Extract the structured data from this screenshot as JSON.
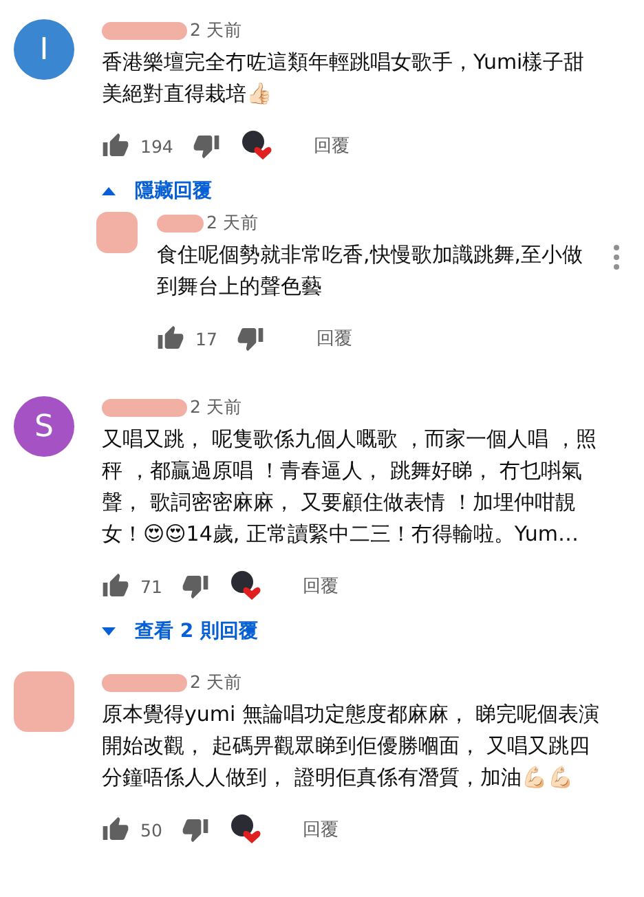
{
  "comments": [
    {
      "avatar": {
        "kind": "letter",
        "letter": "I",
        "color": "#3a86d1"
      },
      "time": "2 天前",
      "text": "香港樂壇完全冇咗這類年輕跳唱女歌手，Yumi樣子甜美絕對直得栽培👍🏻",
      "likes": "194",
      "creator_heart": true,
      "reply": "回覆",
      "replies_toggle": {
        "expanded": true,
        "label": "隱藏回覆"
      },
      "replies": [
        {
          "avatar": {
            "kind": "redacted"
          },
          "time": "2 天前",
          "text": "食住呢個勢就非常吃香,快慢歌加識跳舞,至小做到舞台上的聲色藝",
          "likes": "17",
          "creator_heart": false,
          "reply": "回覆",
          "menu": true
        }
      ]
    },
    {
      "avatar": {
        "kind": "letter",
        "letter": "S",
        "color": "#a552c4"
      },
      "time": "2 天前",
      "text": "又唱又跳， 呢隻歌係九個人嘅歌 ，而家一個人唱 ，照秤 ，都贏過原唱 ！青春逼人， 跳舞好睇， 冇乜唞氣聲， 歌詞密密麻麻， 又要顧住做表情 ！加埋仲咁靚女！😍😍14歲, 正常讀緊中二三！冇得輸啦。Yum…",
      "likes": "71",
      "creator_heart": true,
      "reply": "回覆",
      "replies_toggle": {
        "expanded": false,
        "label": "查看 2 則回覆"
      }
    },
    {
      "avatar": {
        "kind": "redacted"
      },
      "time": "2 天前",
      "text": "原本覺得yumi 無論唱功定態度都麻麻， 睇完呢個表演開始改觀， 起碼畀觀眾睇到佢優勝嗰面， 又唱又跳四分鐘唔係人人做到， 證明佢真係有潛質，加油💪🏻💪🏻",
      "likes": "50",
      "creator_heart": true,
      "reply": "回覆"
    }
  ]
}
